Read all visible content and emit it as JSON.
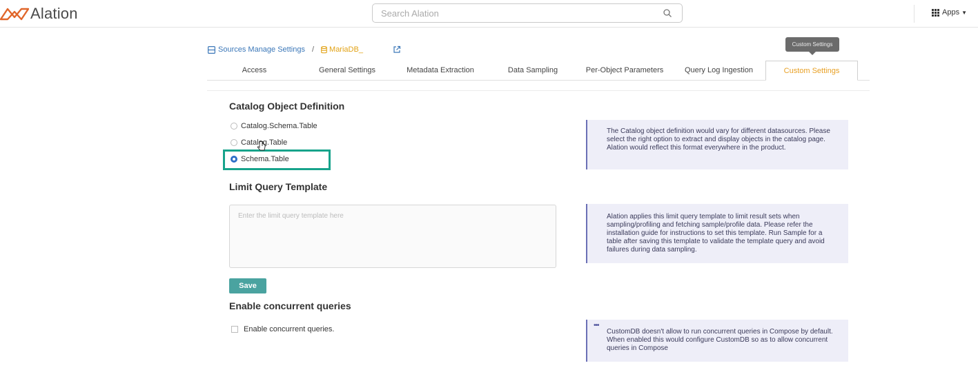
{
  "app": {
    "logo_text": "Alation",
    "brand_color": "#e0662a"
  },
  "search": {
    "placeholder": "Search Alation",
    "icon": "search-icon"
  },
  "apps_menu": {
    "label": "Apps",
    "icon": "grid-icon"
  },
  "tooltip": {
    "text": "Custom Settings"
  },
  "breadcrumb": {
    "parent_label": "Sources Manage Settings",
    "separator": "/",
    "current_label": "MariaDB_"
  },
  "tabs": [
    {
      "label": "Access",
      "active": false
    },
    {
      "label": "General Settings",
      "active": false
    },
    {
      "label": "Metadata Extraction",
      "active": false
    },
    {
      "label": "Data Sampling",
      "active": false
    },
    {
      "label": "Per-Object Parameters",
      "active": false
    },
    {
      "label": "Query Log Ingestion",
      "active": false
    },
    {
      "label": "Custom Settings",
      "active": true
    }
  ],
  "catalog_section": {
    "title": "Catalog Object Definition",
    "options": [
      {
        "label": "Catalog.Schema.Table",
        "selected": false
      },
      {
        "label": "Catalog.Table",
        "selected": false
      },
      {
        "label": "Schema.Table",
        "selected": true
      }
    ],
    "info": "The Catalog object definition would vary for different datasources. Please select the right option to extract and display objects in the catalog page. Alation would reflect this format everywhere in the product."
  },
  "limit_section": {
    "title": "Limit Query Template",
    "placeholder": "Enter the limit query template here",
    "value": "",
    "info": "Alation applies this limit query template to limit result sets when sampling/profiling and fetching sample/profile data. Please refer the installation guide for instructions to set this template. Run Sample for a table after saving this template to validate the template query and avoid failures during data sampling.",
    "save_label": "Save"
  },
  "concurrent_section": {
    "title": "Enable concurrent queries",
    "checkbox_label": "Enable concurrent queries.",
    "checked": false,
    "info": "CustomDB doesn't allow to run concurrent queries in Compose by default. When enabled this would configure CustomDB so as to allow concurrent queries in Compose"
  },
  "colors": {
    "accent_tab": "#e8a025",
    "link": "#3b77b8",
    "save_button": "#4aa3a0",
    "highlight": "#17a38b",
    "info_bg": "#eeeef8"
  }
}
